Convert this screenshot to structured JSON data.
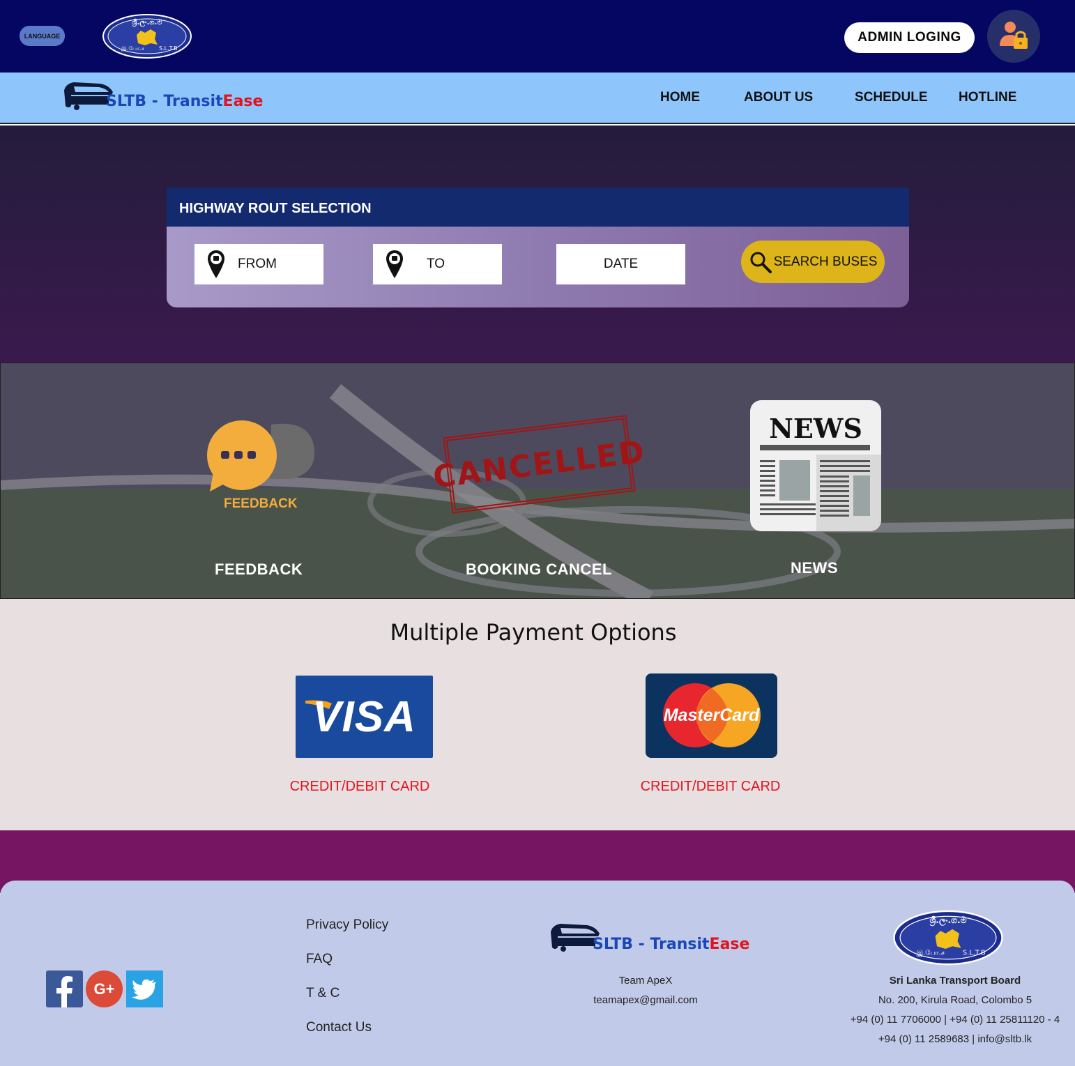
{
  "header": {
    "language_label": "LANGUAGE",
    "admin_label": "ADMIN LOGING",
    "seal_text_top": "ශ්‍රී.ලං.ග.ම",
    "seal_text_bottom_left": "இ.போ.ச",
    "seal_text_bottom_right": "S.L.T.B"
  },
  "brand": {
    "name": "SLTB - Transit",
    "accent": "Ease"
  },
  "nav": {
    "items": [
      "HOME",
      "ABOUT US",
      "SCHEDULE",
      "HOTLINE"
    ]
  },
  "route": {
    "title": "HIGHWAY ROUT SELECTION",
    "from_label": "FROM",
    "to_label": "TO",
    "date_label": "DATE",
    "search_label": "SEARCH BUSES"
  },
  "features": {
    "feedback_icon_label": "FEEDBACK",
    "cancelled_stamp": "CANCELLED",
    "news_icon_label": "NEWS",
    "feedback": "FEEDBACK",
    "booking_cancel": "BOOKING CANCEL",
    "news": "NEWS"
  },
  "payment": {
    "title": "Multiple Payment Options",
    "visa_brand": "VISA",
    "mastercard_brand": "MasterCard",
    "visa_label": "CREDIT/DEBIT CARD",
    "mastercard_label": "CREDIT/DEBIT CARD"
  },
  "footer": {
    "links": [
      "Privacy Policy",
      "FAQ",
      "T & C",
      "Contact Us"
    ],
    "team": "Team ApeX",
    "email": "teamapex@gmail.com",
    "org_name": "Sri Lanka Transport Board",
    "address": "No. 200, Kirula Road, Colombo 5",
    "phone1": "+94 (0) 11 7706000 | +94 (0) 11 25811120 - 4",
    "phone2": "+94 (0) 11 2589683 | info@sltb.lk"
  },
  "colors": {
    "topbar": "#050562",
    "navbar": "#8ec6fc",
    "accent_red": "#e3141c",
    "search_yellow": "#ddb41a",
    "footer": "#c1cbe9"
  }
}
